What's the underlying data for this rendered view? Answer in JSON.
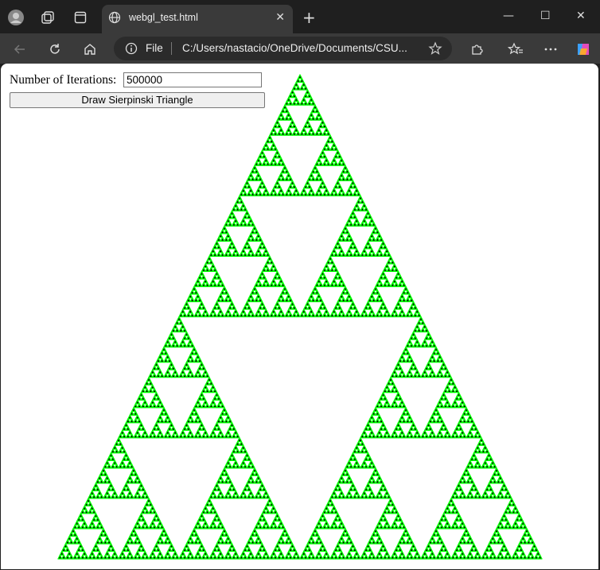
{
  "browser": {
    "tab": {
      "title": "webgl_test.html"
    },
    "address": {
      "scheme_label": "File",
      "url": "C:/Users/nastacio/OneDrive/Documents/CSU..."
    },
    "icons": [
      "profile-icon",
      "workspaces-icon",
      "tab-actions-icon",
      "globe-icon",
      "close-icon",
      "new-tab-icon",
      "minimize-icon",
      "maximize-icon",
      "window-close-icon",
      "back-icon",
      "refresh-icon",
      "home-icon",
      "info-icon",
      "favorite-star-icon",
      "extensions-icon",
      "favorites-icon",
      "more-icon",
      "copilot-icon"
    ]
  },
  "page": {
    "iterations_label": "Number of Iterations:",
    "iterations_value": "500000",
    "draw_button_label": "Draw Sierpinski Triangle"
  },
  "colors": {
    "fill": "#000000",
    "outline": "#00ff00",
    "background": "#ffffff"
  }
}
